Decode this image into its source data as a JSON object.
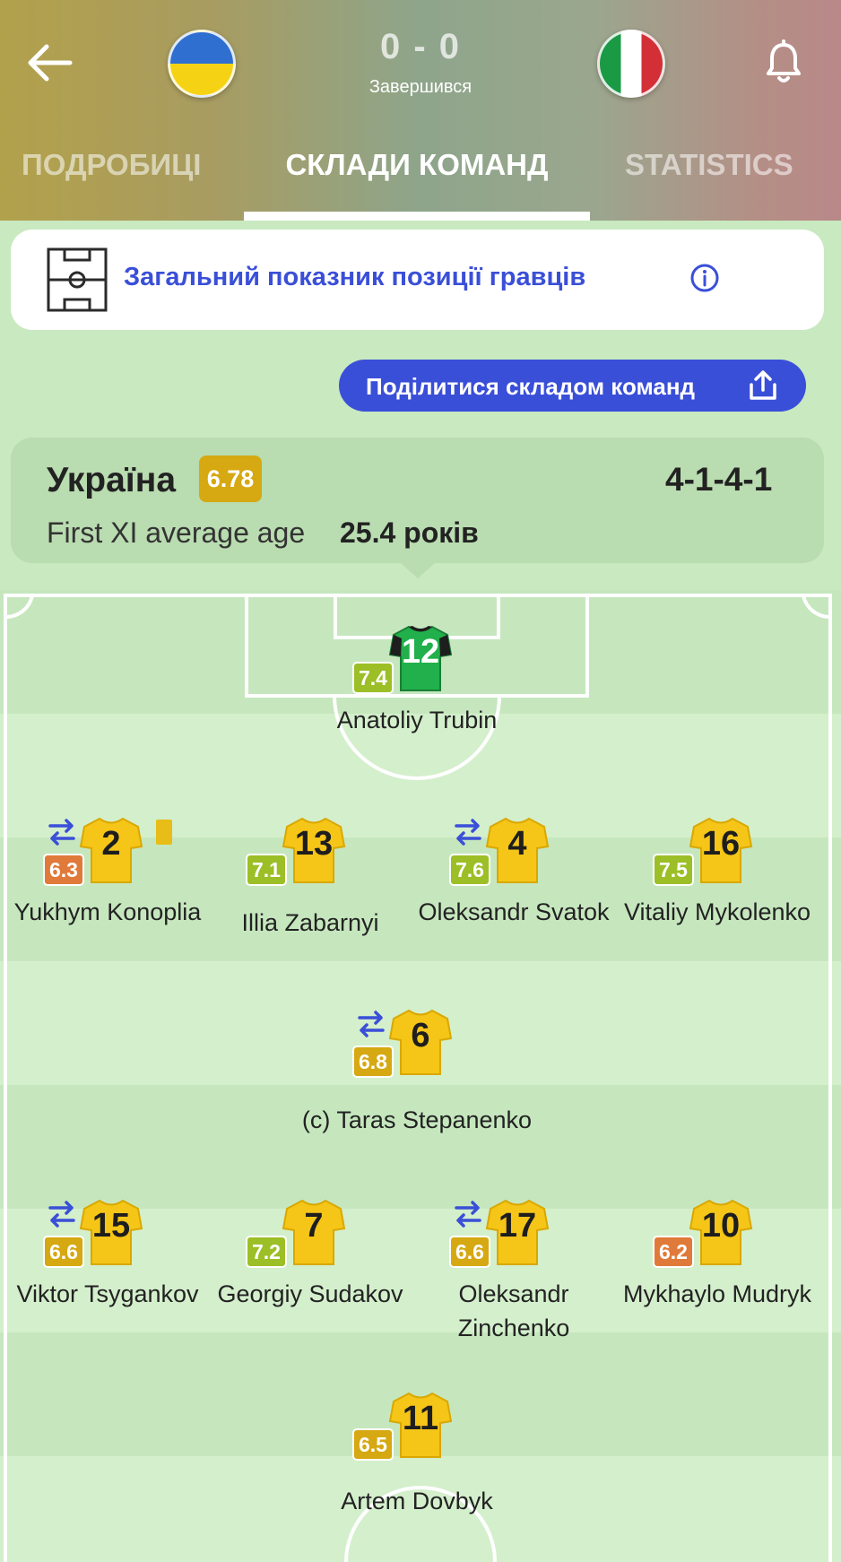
{
  "header": {
    "score": "0 - 0",
    "status": "Завершився",
    "tabs": [
      {
        "label": "ПОДРОБИЦІ",
        "active": false
      },
      {
        "label": "СКЛАДИ КОМАНД",
        "active": true
      },
      {
        "label": "STATISTICS",
        "active": false
      }
    ]
  },
  "info_card": {
    "label": "Загальний показник позиції гравців"
  },
  "share_button": {
    "label": "Поділитися складом команд"
  },
  "team": {
    "name": "Україна",
    "rating": "6.78",
    "formation": "4-1-4-1",
    "age_label": "First XI average age",
    "age_value": "25.4 років"
  },
  "players": [
    {
      "number": "12",
      "name": "Anatoliy Trubin",
      "rating": "7.4",
      "rating_color": "#9cbf27",
      "substituted": false,
      "yellow_card": false,
      "goalkeeper": true
    },
    {
      "number": "2",
      "name": "Yukhym Konoplia",
      "rating": "6.3",
      "rating_color": "#e07a3a",
      "substituted": true,
      "yellow_card": true,
      "goalkeeper": false
    },
    {
      "number": "13",
      "name": "Illia Zabarnyi",
      "rating": "7.1",
      "rating_color": "#9cbf27",
      "substituted": false,
      "yellow_card": false,
      "goalkeeper": false
    },
    {
      "number": "4",
      "name": "Oleksandr Svatok",
      "rating": "7.6",
      "rating_color": "#9cbf27",
      "substituted": true,
      "yellow_card": false,
      "goalkeeper": false
    },
    {
      "number": "16",
      "name": "Vitaliy Mykolenko",
      "rating": "7.5",
      "rating_color": "#9cbf27",
      "substituted": false,
      "yellow_card": false,
      "goalkeeper": false
    },
    {
      "number": "6",
      "name": "(c) Taras Stepanenko",
      "rating": "6.8",
      "rating_color": "#d6a812",
      "substituted": true,
      "yellow_card": false,
      "goalkeeper": false
    },
    {
      "number": "15",
      "name": "Viktor Tsygankov",
      "rating": "6.6",
      "rating_color": "#d6a812",
      "substituted": true,
      "yellow_card": false,
      "goalkeeper": false
    },
    {
      "number": "7",
      "name": "Georgiy Sudakov",
      "rating": "7.2",
      "rating_color": "#9cbf27",
      "substituted": false,
      "yellow_card": false,
      "goalkeeper": false
    },
    {
      "number": "17",
      "name": "Oleksandr Zinchenko",
      "rating": "6.6",
      "rating_color": "#d6a812",
      "substituted": true,
      "yellow_card": false,
      "goalkeeper": false
    },
    {
      "number": "10",
      "name": "Mykhaylo Mudryk",
      "rating": "6.2",
      "rating_color": "#e07a3a",
      "substituted": false,
      "yellow_card": false,
      "goalkeeper": false
    },
    {
      "number": "11",
      "name": "Artem Dovbyk",
      "rating": "6.5",
      "rating_color": "#d6a812",
      "substituted": false,
      "yellow_card": false,
      "goalkeeper": false
    }
  ]
}
